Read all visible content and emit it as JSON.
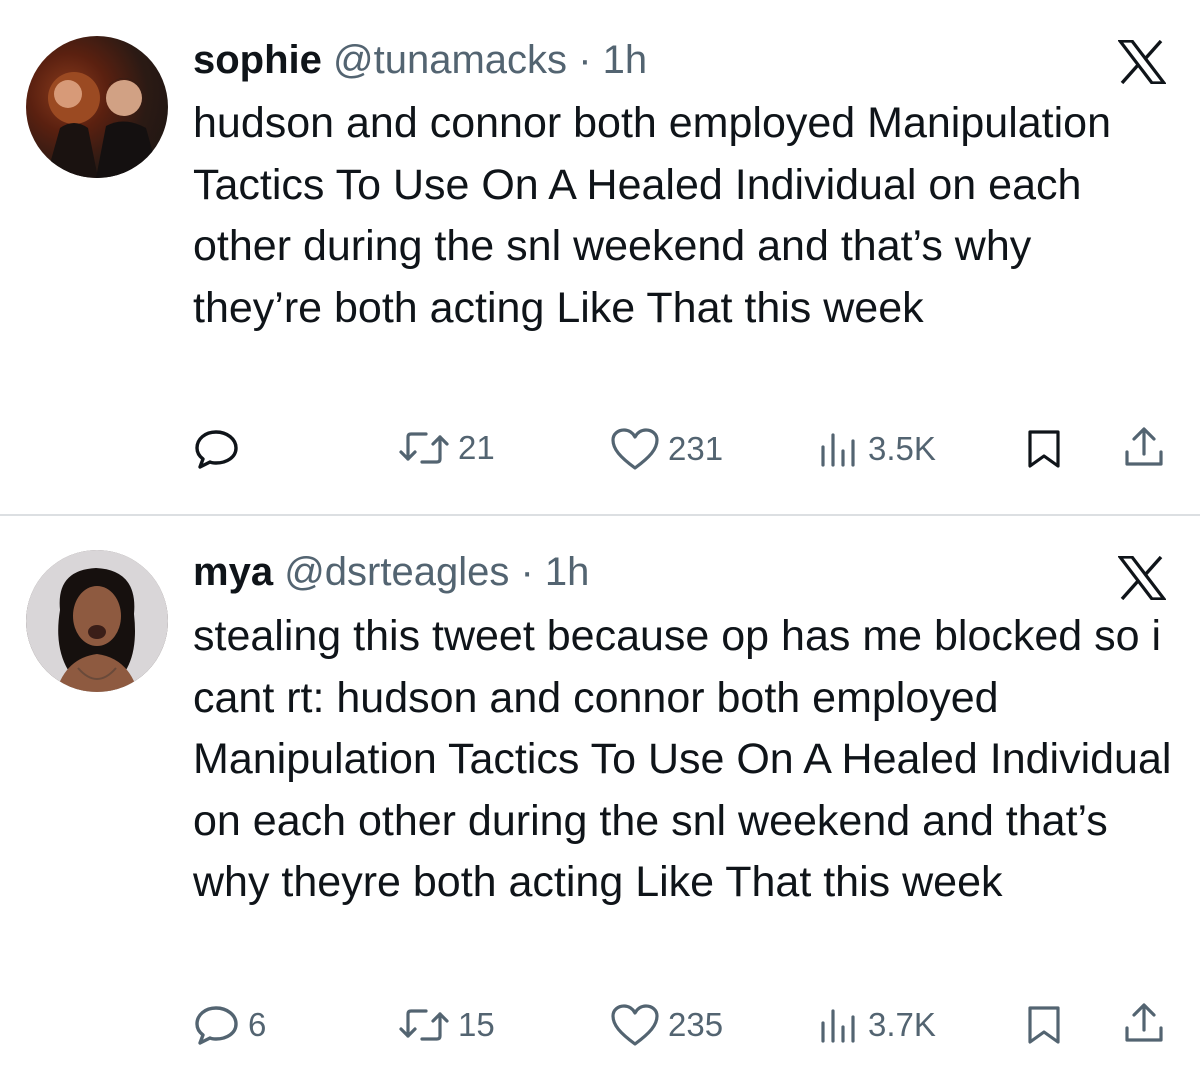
{
  "tweets": [
    {
      "name": "sophie",
      "handle": "@tunamacks",
      "separator": "·",
      "time": "1h",
      "text": "hudson and connor both employed Manipulation Tactics To Use On A Healed Individual on each other during the snl weekend and that’s why they’re both acting Like That this week",
      "replies": "",
      "retweets": "21",
      "likes": "231",
      "views": "3.5K",
      "icons": [
        "avatar",
        "x-logo-icon",
        "reply-icon",
        "retweet-icon",
        "like-icon",
        "views-icon",
        "bookmark-icon",
        "share-icon"
      ]
    },
    {
      "name": "mya",
      "handle": "@dsrteagles",
      "separator": "·",
      "time": "1h",
      "text": "stealing this tweet because op has me blocked so i cant rt: hudson and connor both employed Manipulation Tactics To Use On A Healed Individual on each other during the snl weekend and that’s why theyre both acting Like That this week",
      "replies": "6",
      "retweets": "15",
      "likes": "235",
      "views": "3.7K",
      "icons": [
        "avatar",
        "x-logo-icon",
        "reply-icon",
        "retweet-icon",
        "like-icon",
        "views-icon",
        "bookmark-icon",
        "share-icon"
      ]
    }
  ],
  "colors": {
    "text": "#0f1419",
    "secondary": "#536471",
    "divider": "#dcdfe2",
    "background": "#ffffff"
  }
}
